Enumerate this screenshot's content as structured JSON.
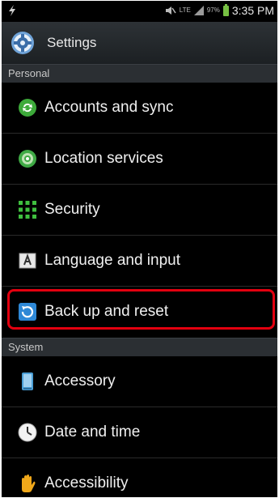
{
  "status_bar": {
    "battery_pct": "97%",
    "time": "3:35 PM",
    "network": "LTE"
  },
  "header": {
    "title": "Settings"
  },
  "sections": {
    "personal": "Personal",
    "system": "System"
  },
  "personal_items": [
    {
      "label": "Accounts and sync",
      "icon": "sync-icon"
    },
    {
      "label": "Location services",
      "icon": "location-icon"
    },
    {
      "label": "Security",
      "icon": "security-grid-icon"
    },
    {
      "label": "Language and input",
      "icon": "language-icon"
    },
    {
      "label": "Back up and reset",
      "icon": "backup-reset-icon"
    }
  ],
  "system_items": [
    {
      "label": "Accessory",
      "icon": "accessory-icon"
    },
    {
      "label": "Date and time",
      "icon": "clock-icon"
    },
    {
      "label": "Accessibility",
      "icon": "hand-icon"
    }
  ],
  "colors": {
    "highlight": "#e3000f",
    "battery": "#77c043",
    "sync": "#3daa3a",
    "backup": "#2e88d6"
  }
}
